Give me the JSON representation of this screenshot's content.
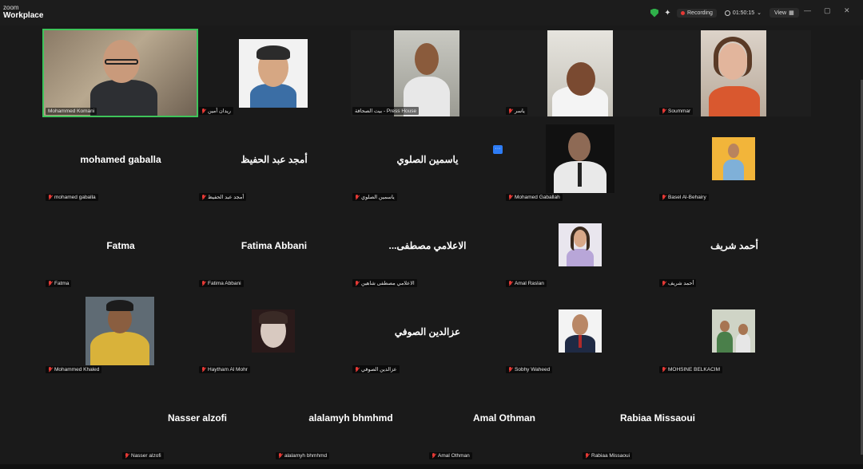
{
  "app": {
    "brand_small": "zoom",
    "brand_name": "Workplace"
  },
  "topbar": {
    "recording_label": "Recording",
    "timer": "01:50:15",
    "view_label": "View",
    "accent_green": "#2fb04a",
    "record_red": "#e53935"
  },
  "participants": {
    "r1": [
      {
        "label": "Mohammed Komani"
      },
      {
        "label": "ريدان أمين"
      },
      {
        "label": "بيت الصحافة - Press House"
      },
      {
        "label": "ياسر"
      },
      {
        "label": "Soummar"
      }
    ],
    "r2": [
      {
        "big": "mohamed gaballa",
        "label": "mohamed gaballa"
      },
      {
        "big": "أمجد عبد الحفيظ",
        "label": "أمجد عبد الحفيظ"
      },
      {
        "big": "ياسمين الصلوي",
        "label": "ياسمين الصلوي"
      },
      {
        "label": "Mohamed Gaballah"
      },
      {
        "label": "Basel Al-Behairy"
      }
    ],
    "r3": [
      {
        "big": "Fatma",
        "label": "Fatma"
      },
      {
        "big": "Fatima Abbani",
        "label": "Fatima Abbani"
      },
      {
        "big": "...الاعلامي  مصطفى",
        "label": "الاعلامي مصطفى شاهين"
      },
      {
        "label": "Amal Raslan"
      },
      {
        "big": "أحمد شريف",
        "label": "أحمد شريف"
      }
    ],
    "r4": [
      {
        "label": "Mohammed Khaled"
      },
      {
        "label": "Haytham Al Mohr"
      },
      {
        "big": "عزالدين الصوفي",
        "label": "عزالدين الصوفي"
      },
      {
        "label": "Sobhy Waheed"
      },
      {
        "label": "MOHSINE BELKACIM"
      }
    ],
    "r5": [
      {
        "big": "Nasser alzofi",
        "label": "Nasser alzofi"
      },
      {
        "big": "alalamyh bhmhmd",
        "label": "alalamyh bhmhmd"
      },
      {
        "big": "Amal Othman",
        "label": "Amal Othman"
      },
      {
        "big": "Rabiaa Missaoui",
        "label": "Rabiaa Missaoui"
      }
    ]
  },
  "more_label": "···"
}
